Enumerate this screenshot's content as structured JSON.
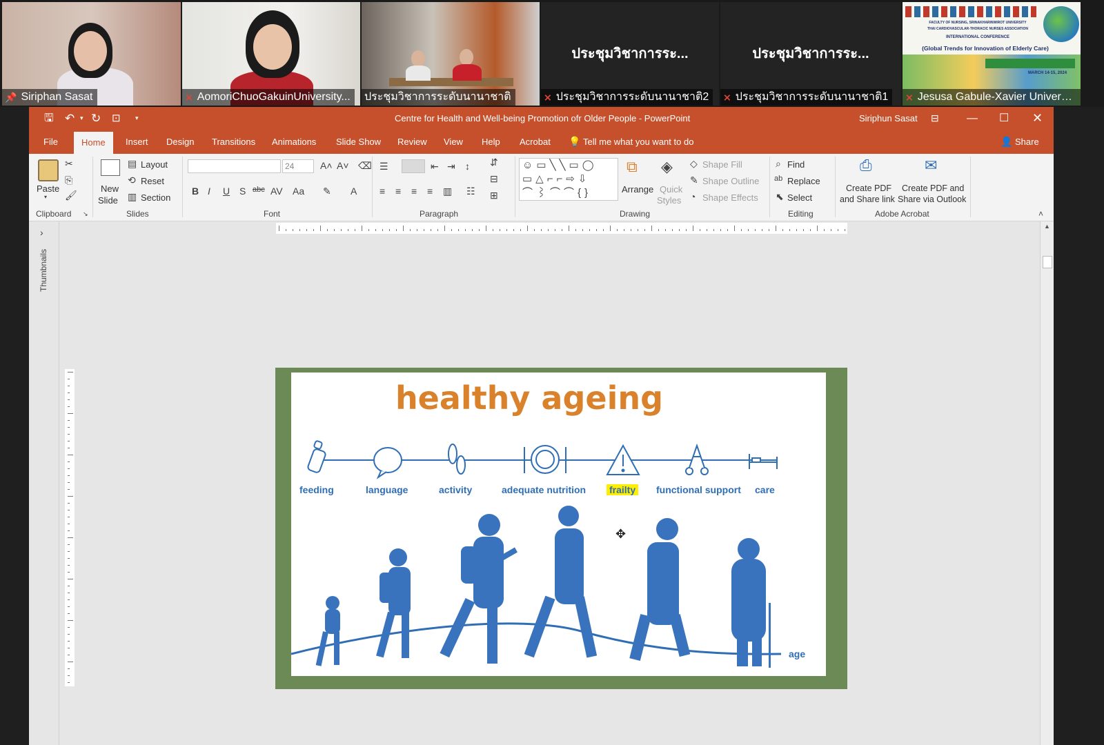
{
  "participants": [
    {
      "name": "Siriphan Sasat",
      "icon": "pin-icon",
      "active": true
    },
    {
      "name": "AomoriChuoGakuinUniversity...",
      "icon": "mic-off-icon"
    },
    {
      "name": "ประชุมวิชาการระดับนานาชาติ",
      "icon": "none"
    },
    {
      "name": "ประชุมวิชาการระดับนานาชาติ2",
      "icon": "mic-off-icon",
      "big_label": "ประชุมวิชาการระ..."
    },
    {
      "name": "ประชุมวิชาการระดับนานาชาติ1",
      "icon": "mic-off-icon",
      "big_label": "ประชุมวิชาการระ..."
    },
    {
      "name": "Jesusa Gabule-Xavier Universi...",
      "icon": "mic-off-icon"
    }
  ],
  "conference_banner": {
    "line1": "FACULTY OF NURSING, SRINAKHARINWIROT UNIVERSITY",
    "line2": "THAI CARDIOVASCULAR-THORACIC NURSES ASSOCIATION",
    "line3": "INTERNATIONAL CONFERENCE",
    "line4": "(Global Trends for Innovation of Elderly Care)",
    "date": "MARCH 14-15, 2024"
  },
  "window": {
    "title": "Centre for Health and Well-being Promotion ofr Older People  -  PowerPoint",
    "user": "Siriphun Sasat",
    "share": "Share",
    "tell_me": "Tell me what you want to do"
  },
  "tabs": [
    "File",
    "Home",
    "Insert",
    "Design",
    "Transitions",
    "Animations",
    "Slide Show",
    "Review",
    "View",
    "Help",
    "Acrobat"
  ],
  "ribbon": {
    "paste": "Paste",
    "new_slide": "New",
    "new_slide2": "Slide",
    "layout": "Layout",
    "reset": "Reset",
    "section": "Section",
    "font_size": "24",
    "arrange": "Arrange",
    "quick_styles": "Quick",
    "quick_styles2": "Styles",
    "shape_fill": "Shape Fill",
    "shape_outline": "Shape Outline",
    "shape_effects": "Shape Effects",
    "find": "Find",
    "replace": "Replace",
    "select": "Select",
    "pdf_share_link_1": "Create PDF",
    "pdf_share_link_2": "and Share link",
    "pdf_outlook_1": "Create PDF and",
    "pdf_outlook_2": "Share via Outlook",
    "groups": [
      "Clipboard",
      "Slides",
      "Font",
      "Paragraph",
      "Drawing",
      "Editing",
      "Adobe Acrobat"
    ]
  },
  "thumbnails_label": "Thumbnails",
  "slide": {
    "title": "healthy ageing",
    "stages": [
      "feeding",
      "language",
      "activity",
      "adequate nutrition",
      "frailty",
      "functional support",
      "care"
    ],
    "highlighted_stage": "frailty",
    "axis_label": "age",
    "accent": "#2f6eb5",
    "title_color": "#d9822b"
  }
}
